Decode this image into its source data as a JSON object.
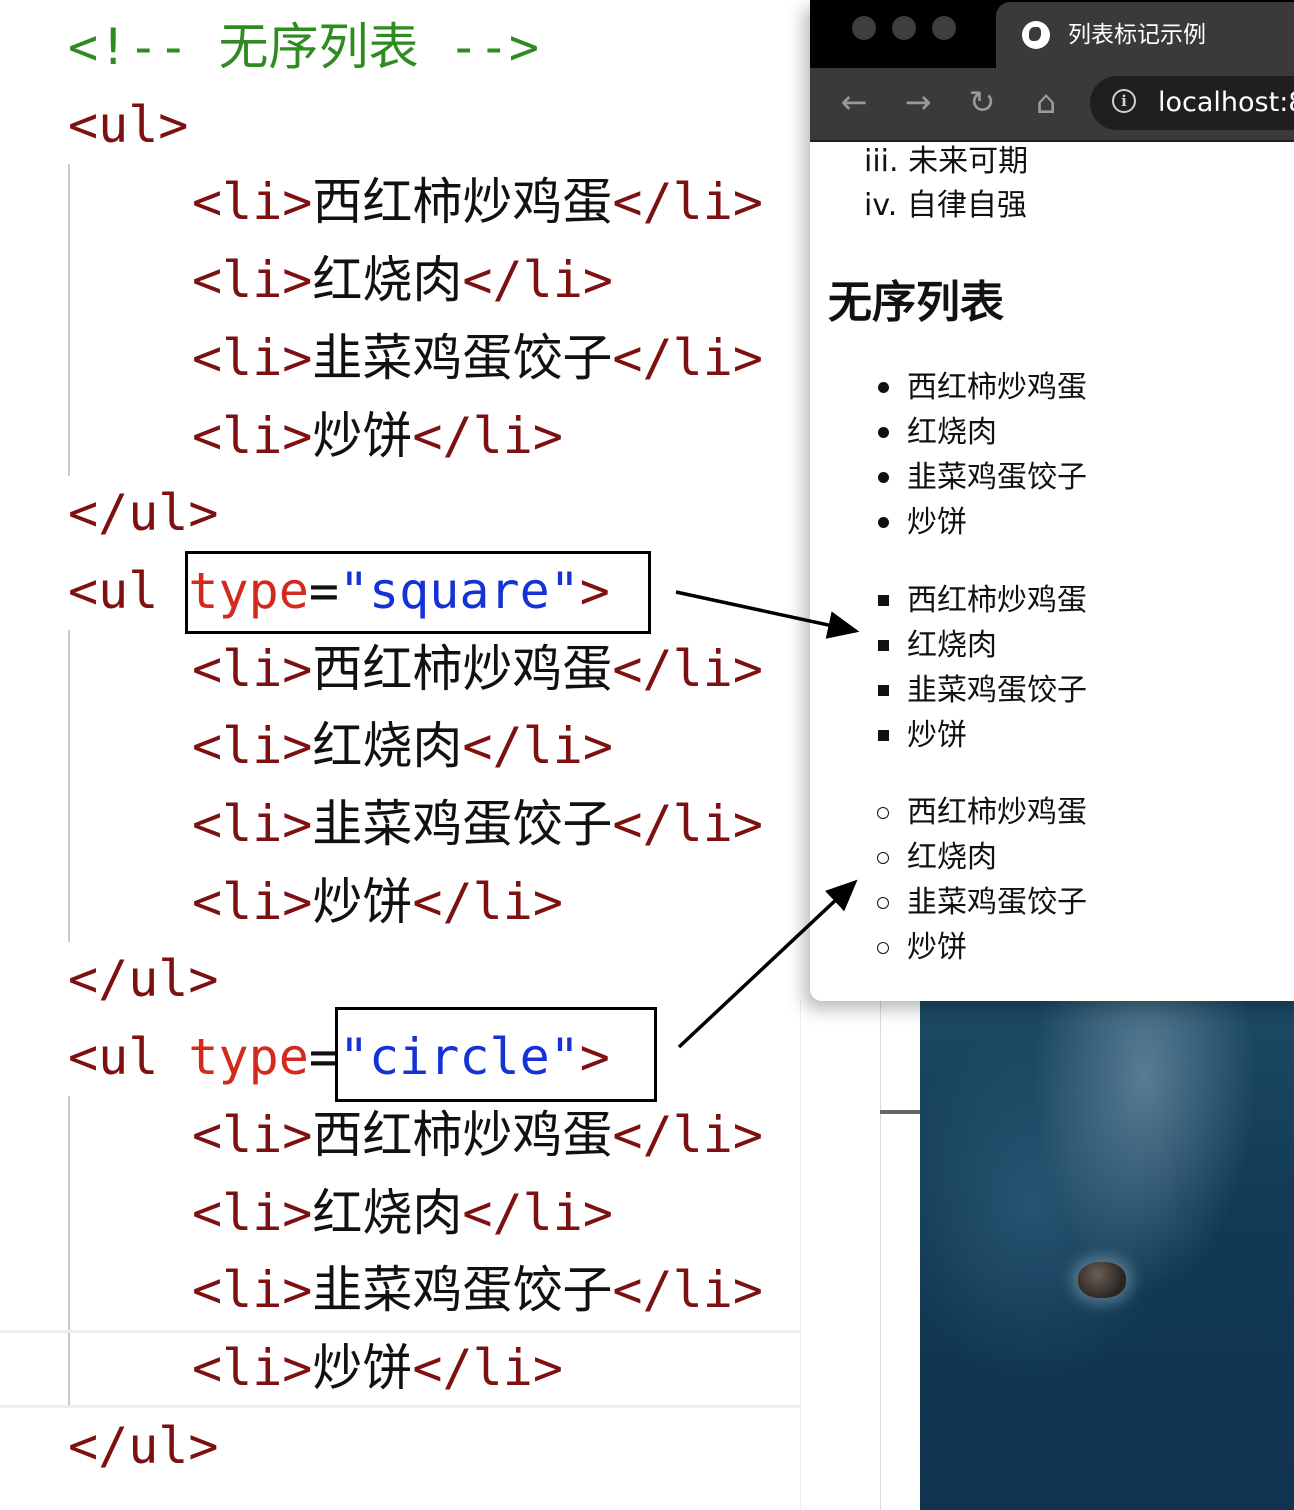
{
  "editor": {
    "lines": [
      {
        "kind": "comment",
        "text": "<!-- 无序列表 -->"
      },
      {
        "kind": "open",
        "tag": "ul"
      },
      {
        "kind": "li",
        "text": "西红柿炒鸡蛋"
      },
      {
        "kind": "li",
        "text": "红烧肉"
      },
      {
        "kind": "li",
        "text": "韭菜鸡蛋饺子"
      },
      {
        "kind": "li",
        "text": "炒饼"
      },
      {
        "kind": "close",
        "tag": "ul"
      },
      {
        "kind": "open-attr",
        "tag": "ul",
        "attr": "type",
        "value": "square"
      },
      {
        "kind": "li",
        "text": "西红柿炒鸡蛋"
      },
      {
        "kind": "li",
        "text": "红烧肉"
      },
      {
        "kind": "li",
        "text": "韭菜鸡蛋饺子"
      },
      {
        "kind": "li",
        "text": "炒饼"
      },
      {
        "kind": "close",
        "tag": "ul"
      },
      {
        "kind": "open-attr",
        "tag": "ul",
        "attr": "type",
        "value": "circle"
      },
      {
        "kind": "li",
        "text": "西红柿炒鸡蛋"
      },
      {
        "kind": "li",
        "text": "红烧肉"
      },
      {
        "kind": "li",
        "text": "韭菜鸡蛋饺子"
      },
      {
        "kind": "li",
        "text": "炒饼"
      },
      {
        "kind": "close",
        "tag": "ul"
      }
    ],
    "colors": {
      "comment": "#2e8b1f",
      "tag": "#7d1010",
      "attr": "#d22b1e",
      "string": "#1432d6",
      "text": "#111111"
    }
  },
  "browser": {
    "tab_title": "列表标记示例",
    "url": "localhost:8",
    "nav": {
      "back": "←",
      "forward": "→",
      "reload": "↻",
      "home": "⌂"
    },
    "ol_items": [
      {
        "marker": "iii.",
        "text": "未来可期"
      },
      {
        "marker": "iv.",
        "text": "自律自强"
      }
    ],
    "heading": "无序列表",
    "lists": [
      {
        "type": "disc",
        "items": [
          "西红柿炒鸡蛋",
          "红烧肉",
          "韭菜鸡蛋饺子",
          "炒饼"
        ]
      },
      {
        "type": "square",
        "items": [
          "西红柿炒鸡蛋",
          "红烧肉",
          "韭菜鸡蛋饺子",
          "炒饼"
        ]
      },
      {
        "type": "circle",
        "items": [
          "西红柿炒鸡蛋",
          "红烧肉",
          "韭菜鸡蛋饺子",
          "炒饼"
        ]
      }
    ]
  }
}
